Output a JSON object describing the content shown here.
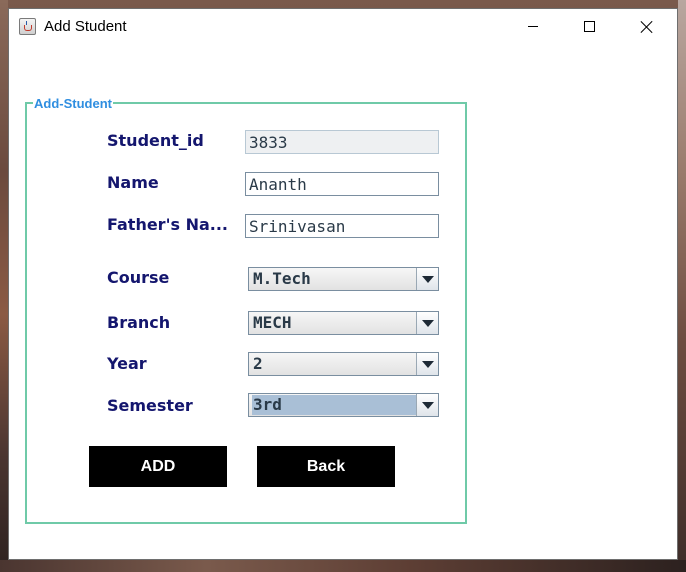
{
  "window": {
    "title": "Add Student",
    "app_icon": "java-cup-icon",
    "controls": [
      "minimize-icon",
      "maximize-icon",
      "close-icon"
    ]
  },
  "form": {
    "group_title": "Add-Student",
    "fields": {
      "student_id": {
        "label": "Student_id",
        "value": "3833",
        "editable": false
      },
      "name": {
        "label": "Name",
        "value": "Ananth"
      },
      "father_name": {
        "label": "Father's Na...",
        "value": "Srinivasan"
      }
    },
    "dropdowns": {
      "course": {
        "label": "Course",
        "selected": "M.Tech"
      },
      "branch": {
        "label": "Branch",
        "selected": "MECH"
      },
      "year": {
        "label": "Year",
        "selected": "2"
      },
      "semester": {
        "label": "Semester",
        "selected": "3rd",
        "focused": true
      }
    },
    "buttons": {
      "add": "ADD",
      "back": "Back"
    }
  },
  "colors": {
    "label_text": "#14166e",
    "group_border": "#6fcaa8",
    "group_title": "#2f8ee0",
    "button_bg": "#000000",
    "button_text": "#ffffff",
    "selection_highlight": "#a9bfd6"
  }
}
